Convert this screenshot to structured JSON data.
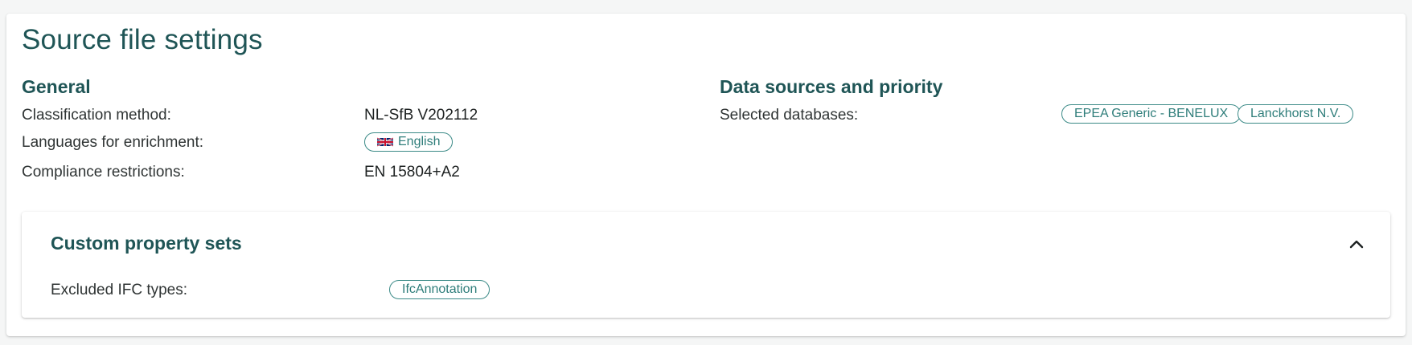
{
  "page": {
    "title": "Source file settings"
  },
  "general": {
    "heading": "General",
    "classification_label": "Classification method:",
    "classification_value": "NL-SfB V202112",
    "languages_label": "Languages for enrichment:",
    "languages": [
      {
        "label": "English",
        "icon": "uk-flag-icon"
      }
    ],
    "compliance_label": "Compliance restrictions:",
    "compliance_value": "EN 15804+A2"
  },
  "data_sources": {
    "heading": "Data sources and priority",
    "databases_label": "Selected databases:",
    "databases": [
      "EPEA Generic - BENELUX",
      "Lanckhorst N.V."
    ]
  },
  "custom_property_sets": {
    "heading": "Custom property sets",
    "expanded": true,
    "toggle_icon": "chevron-up-icon",
    "excluded_label": "Excluded IFC types:",
    "excluded_types": [
      "IfcAnnotation"
    ]
  },
  "colors": {
    "heading": "#1f5556",
    "chip_border": "#3b8a87",
    "chip_text": "#2e7d7a"
  }
}
